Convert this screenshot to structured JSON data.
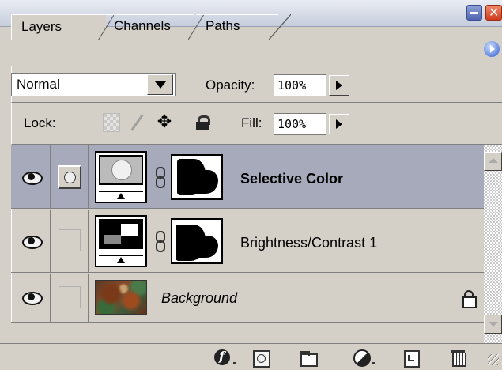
{
  "window": {
    "minimize_icon": "minimize-icon",
    "close_icon": "close-icon"
  },
  "tabs": [
    {
      "label": "Layers",
      "active": true
    },
    {
      "label": "Channels",
      "active": false
    },
    {
      "label": "Paths",
      "active": false
    }
  ],
  "blend": {
    "mode": "Normal",
    "opacity_label": "Opacity:",
    "opacity_value": "100%"
  },
  "lock": {
    "label": "Lock:",
    "fill_label": "Fill:",
    "fill_value": "100%",
    "icons": [
      "lock-transparent-icon",
      "lock-image-icon",
      "lock-position-icon",
      "lock-all-icon"
    ]
  },
  "layers": [
    {
      "name": "Selective Color",
      "visible": true,
      "selected": true,
      "type": "adjustment"
    },
    {
      "name": "Brightness/Contrast 1",
      "visible": true,
      "selected": false,
      "type": "adjustment"
    },
    {
      "name": "Background",
      "visible": true,
      "selected": false,
      "locked": true,
      "italic": true,
      "type": "image"
    }
  ],
  "bottom_toolbar": {
    "icons": [
      "layer-effects-icon",
      "add-mask-icon",
      "new-group-icon",
      "new-adjustment-layer-icon",
      "new-layer-icon",
      "delete-layer-icon"
    ]
  },
  "colors": {
    "panel_bg": "#d4d0c8",
    "selected_row": "#a7aabb",
    "titlebar": "#c6cddb"
  }
}
